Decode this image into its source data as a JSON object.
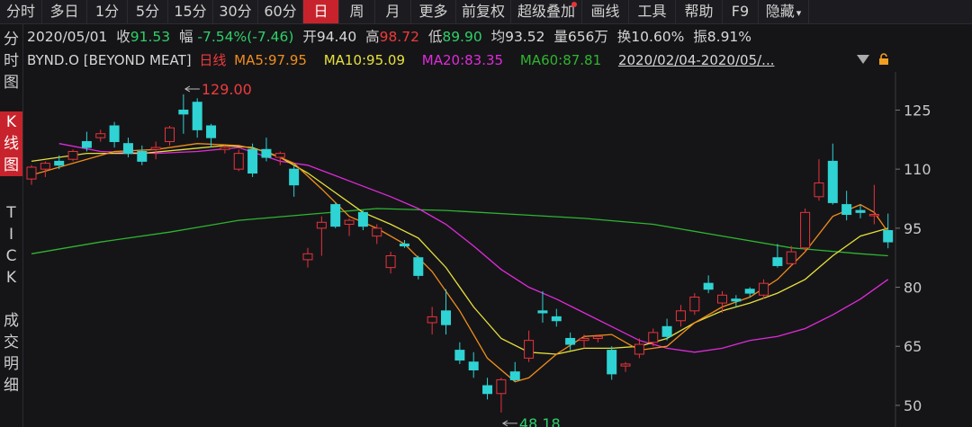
{
  "toolbar": {
    "tabs": [
      "分时",
      "多日",
      "1分",
      "5分",
      "15分",
      "30分",
      "60分",
      "日",
      "周",
      "月",
      "更多",
      "前复权",
      "超级叠加",
      "画线",
      "工具",
      "帮助",
      "F9",
      "隐藏"
    ],
    "active": "日",
    "more_caret": "▾"
  },
  "sidebar": {
    "items": [
      "分时图",
      "K线图",
      "TICK",
      "成交明细"
    ],
    "active": "K线图"
  },
  "info": {
    "date": "2020/05/01",
    "close_label": "收",
    "close": "91.53",
    "change_label": "幅",
    "change": "-7.54%(-7.46)",
    "open_label": "开",
    "open": "94.40",
    "high_label": "高",
    "high": "98.72",
    "low_label": "低",
    "low": "89.90",
    "avg_label": "均",
    "avg": "93.52",
    "volume_label": "量",
    "volume": "656万",
    "turnover_label": "换",
    "turnover": "10.60%",
    "amplitude_label": "振",
    "amplitude": "8.91%"
  },
  "legend": {
    "symbol": "BYND.O [BEYOND MEAT]",
    "period": "日线",
    "ma5": "MA5:97.95",
    "ma10": "MA10:95.09",
    "ma20": "MA20:83.35",
    "ma60": "MA60:87.81",
    "range": "2020/02/04-2020/05/..."
  },
  "colors": {
    "up": "#e8333b",
    "down": "#2fd3d3",
    "ma5": "#f08d1b",
    "ma10": "#e6e03a",
    "ma20": "#e02bd9",
    "ma60": "#2fb52f",
    "active_tab": "#c8232c",
    "axis_label": "#c8c8c8"
  },
  "chart_data": {
    "type": "candlestick",
    "y_ticks": [
      125,
      110,
      95,
      80,
      65,
      50
    ],
    "ylim": [
      44.5,
      134.7
    ],
    "grid": false,
    "annotations": [
      {
        "text": "129.00",
        "value": 129.0,
        "color": "#ee3b3b"
      },
      {
        "text": "48.18",
        "value": 48.18,
        "color": "#2fd067"
      }
    ],
    "candles": [
      {
        "o": 107.5,
        "h": 111.0,
        "l": 106.0,
        "c": 110.5
      },
      {
        "o": 110.0,
        "h": 112.0,
        "l": 108.0,
        "c": 111.5
      },
      {
        "o": 112.0,
        "h": 113.5,
        "l": 110.0,
        "c": 111.0
      },
      {
        "o": 112.5,
        "h": 115.0,
        "l": 112.0,
        "c": 114.5
      },
      {
        "o": 117.0,
        "h": 119.5,
        "l": 114.5,
        "c": 115.5
      },
      {
        "o": 118.0,
        "h": 120.0,
        "l": 117.0,
        "c": 119.0
      },
      {
        "o": 121.0,
        "h": 122.0,
        "l": 115.5,
        "c": 117.0
      },
      {
        "o": 116.5,
        "h": 118.0,
        "l": 113.0,
        "c": 114.0
      },
      {
        "o": 114.5,
        "h": 116.0,
        "l": 111.0,
        "c": 112.0
      },
      {
        "o": 115.0,
        "h": 117.0,
        "l": 112.5,
        "c": 115.5
      },
      {
        "o": 117.0,
        "h": 121.0,
        "l": 116.0,
        "c": 120.5
      },
      {
        "o": 125.0,
        "h": 129.0,
        "l": 119.0,
        "c": 124.0
      },
      {
        "o": 127.0,
        "h": 128.0,
        "l": 118.0,
        "c": 120.0
      },
      {
        "o": 121.0,
        "h": 121.5,
        "l": 115.5,
        "c": 118.0
      },
      {
        "o": 115.0,
        "h": 116.0,
        "l": 114.0,
        "c": 115.5
      },
      {
        "o": 110.0,
        "h": 115.0,
        "l": 109.5,
        "c": 114.0
      },
      {
        "o": 115.0,
        "h": 116.5,
        "l": 108.0,
        "c": 109.0
      },
      {
        "o": 115.0,
        "h": 118.0,
        "l": 112.0,
        "c": 113.0
      },
      {
        "o": 113.0,
        "h": 114.5,
        "l": 111.0,
        "c": 114.0
      },
      {
        "o": 110.0,
        "h": 111.0,
        "l": 103.0,
        "c": 106.0
      },
      {
        "o": 87.0,
        "h": 90.0,
        "l": 85.0,
        "c": 88.5
      },
      {
        "o": 95.0,
        "h": 98.0,
        "l": 88.0,
        "c": 96.5
      },
      {
        "o": 101.0,
        "h": 101.5,
        "l": 95.0,
        "c": 95.5
      },
      {
        "o": 96.0,
        "h": 97.5,
        "l": 93.0,
        "c": 97.0
      },
      {
        "o": 99.0,
        "h": 99.5,
        "l": 94.5,
        "c": 95.5
      },
      {
        "o": 93.0,
        "h": 96.0,
        "l": 91.0,
        "c": 95.0
      },
      {
        "o": 85.0,
        "h": 89.0,
        "l": 83.5,
        "c": 88.0
      },
      {
        "o": 91.0,
        "h": 92.0,
        "l": 90.0,
        "c": 90.5
      },
      {
        "o": 87.5,
        "h": 88.0,
        "l": 82.0,
        "c": 83.0
      },
      {
        "o": 71.0,
        "h": 75.0,
        "l": 68.0,
        "c": 72.5
      },
      {
        "o": 74.0,
        "h": 79.5,
        "l": 68.0,
        "c": 70.5
      },
      {
        "o": 64.0,
        "h": 66.0,
        "l": 60.5,
        "c": 61.5
      },
      {
        "o": 61.0,
        "h": 63.5,
        "l": 57.0,
        "c": 59.0
      },
      {
        "o": 55.0,
        "h": 57.0,
        "l": 51.5,
        "c": 53.0
      },
      {
        "o": 53.0,
        "h": 57.0,
        "l": 48.18,
        "c": 56.5
      },
      {
        "o": 58.5,
        "h": 61.0,
        "l": 56.0,
        "c": 56.5
      },
      {
        "o": 62.0,
        "h": 69.0,
        "l": 61.0,
        "c": 66.5
      },
      {
        "o": 74.0,
        "h": 79.0,
        "l": 71.0,
        "c": 73.5
      },
      {
        "o": 72.5,
        "h": 74.5,
        "l": 70.0,
        "c": 71.5
      },
      {
        "o": 67.0,
        "h": 68.5,
        "l": 64.0,
        "c": 65.5
      },
      {
        "o": 66.5,
        "h": 68.0,
        "l": 64.5,
        "c": 67.0
      },
      {
        "o": 67.0,
        "h": 68.0,
        "l": 66.0,
        "c": 67.5
      },
      {
        "o": 64.0,
        "h": 65.0,
        "l": 56.5,
        "c": 58.0
      },
      {
        "o": 60.0,
        "h": 61.0,
        "l": 58.5,
        "c": 60.5
      },
      {
        "o": 63.0,
        "h": 67.0,
        "l": 62.0,
        "c": 65.5
      },
      {
        "o": 66.0,
        "h": 69.5,
        "l": 65.0,
        "c": 68.5
      },
      {
        "o": 70.0,
        "h": 72.0,
        "l": 66.5,
        "c": 67.5
      },
      {
        "o": 71.5,
        "h": 75.5,
        "l": 70.0,
        "c": 74.0
      },
      {
        "o": 74.0,
        "h": 78.5,
        "l": 73.0,
        "c": 77.5
      },
      {
        "o": 81.0,
        "h": 83.0,
        "l": 78.5,
        "c": 79.5
      },
      {
        "o": 76.0,
        "h": 79.0,
        "l": 73.5,
        "c": 78.0
      },
      {
        "o": 77.0,
        "h": 78.0,
        "l": 75.0,
        "c": 76.5
      },
      {
        "o": 79.5,
        "h": 80.0,
        "l": 77.5,
        "c": 78.5
      },
      {
        "o": 78.0,
        "h": 82.0,
        "l": 77.0,
        "c": 81.0
      },
      {
        "o": 87.5,
        "h": 91.0,
        "l": 85.0,
        "c": 85.5
      },
      {
        "o": 86.0,
        "h": 90.5,
        "l": 85.5,
        "c": 89.0
      },
      {
        "o": 90.0,
        "h": 100.0,
        "l": 89.0,
        "c": 99.0
      },
      {
        "o": 103.0,
        "h": 112.5,
        "l": 102.0,
        "c": 106.5
      },
      {
        "o": 112.0,
        "h": 116.5,
        "l": 101.0,
        "c": 101.5
      },
      {
        "o": 101.0,
        "h": 104.5,
        "l": 97.0,
        "c": 98.5
      },
      {
        "o": 99.5,
        "h": 101.0,
        "l": 97.5,
        "c": 99.0
      },
      {
        "o": 98.5,
        "h": 106.0,
        "l": 96.0,
        "c": 98.5
      },
      {
        "o": 94.4,
        "h": 98.72,
        "l": 89.9,
        "c": 91.53
      }
    ],
    "ma5": [
      [
        0,
        108.5
      ],
      [
        3,
        111.5
      ],
      [
        6,
        114.5
      ],
      [
        9,
        115
      ],
      [
        12,
        116.5
      ],
      [
        15,
        116
      ],
      [
        17,
        114.5
      ],
      [
        19,
        111.5
      ],
      [
        21,
        105
      ],
      [
        23,
        98
      ],
      [
        25,
        95
      ],
      [
        27,
        91
      ],
      [
        29,
        84
      ],
      [
        31,
        74
      ],
      [
        33,
        62
      ],
      [
        35,
        56
      ],
      [
        36,
        57
      ],
      [
        38,
        63
      ],
      [
        40,
        67.5
      ],
      [
        42,
        68
      ],
      [
        44,
        64
      ],
      [
        46,
        65
      ],
      [
        48,
        71
      ],
      [
        50,
        75
      ],
      [
        52,
        77.5
      ],
      [
        54,
        82
      ],
      [
        56,
        89
      ],
      [
        58,
        98
      ],
      [
        60,
        101
      ],
      [
        61,
        99
      ],
      [
        62,
        94
      ]
    ],
    "ma10": [
      [
        0,
        112
      ],
      [
        4,
        114
      ],
      [
        8,
        114
      ],
      [
        11,
        115
      ],
      [
        14,
        116
      ],
      [
        16,
        115.5
      ],
      [
        18,
        113
      ],
      [
        20,
        109
      ],
      [
        22,
        104
      ],
      [
        24,
        99
      ],
      [
        26,
        96
      ],
      [
        28,
        92.5
      ],
      [
        30,
        85
      ],
      [
        32,
        75
      ],
      [
        34,
        67
      ],
      [
        36,
        63.5
      ],
      [
        38,
        63
      ],
      [
        40,
        64.5
      ],
      [
        42,
        64.5
      ],
      [
        44,
        65
      ],
      [
        46,
        67
      ],
      [
        48,
        71
      ],
      [
        50,
        74
      ],
      [
        52,
        76
      ],
      [
        54,
        78.5
      ],
      [
        56,
        82
      ],
      [
        58,
        88
      ],
      [
        60,
        93
      ],
      [
        62,
        95
      ]
    ],
    "ma20": [
      [
        2,
        116.5
      ],
      [
        5,
        114.5
      ],
      [
        9,
        114
      ],
      [
        12,
        114.5
      ],
      [
        15,
        115.5
      ],
      [
        18,
        112
      ],
      [
        20,
        111
      ],
      [
        23,
        107
      ],
      [
        26,
        103
      ],
      [
        28,
        100
      ],
      [
        30,
        96
      ],
      [
        32,
        90.5
      ],
      [
        34,
        84.5
      ],
      [
        36,
        80
      ],
      [
        38,
        77
      ],
      [
        40,
        73.5
      ],
      [
        42,
        70
      ],
      [
        44,
        66.5
      ],
      [
        46,
        64.5
      ],
      [
        48,
        63.5
      ],
      [
        50,
        64.5
      ],
      [
        52,
        66.5
      ],
      [
        54,
        67.5
      ],
      [
        56,
        69.5
      ],
      [
        58,
        73
      ],
      [
        60,
        77
      ],
      [
        62,
        82
      ]
    ],
    "ma60": [
      [
        0,
        88.5
      ],
      [
        5,
        91.5
      ],
      [
        10,
        94
      ],
      [
        15,
        97
      ],
      [
        20,
        98.5
      ],
      [
        25,
        100
      ],
      [
        30,
        99.5
      ],
      [
        35,
        98.5
      ],
      [
        40,
        97.5
      ],
      [
        45,
        96
      ],
      [
        50,
        93
      ],
      [
        55,
        90
      ],
      [
        60,
        88.5
      ],
      [
        62,
        88
      ]
    ]
  }
}
